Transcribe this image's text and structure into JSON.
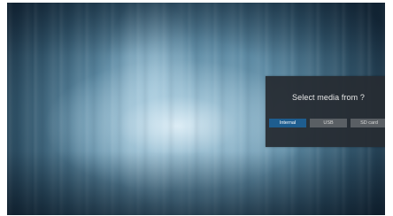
{
  "dialog": {
    "title": "Select media from ?",
    "options": [
      {
        "label": "Internal",
        "selected": true
      },
      {
        "label": "USB",
        "selected": false
      },
      {
        "label": "SD card",
        "selected": false
      }
    ]
  },
  "colors": {
    "selected_option": "#1e5d8f",
    "option": "#5a5f64",
    "dialog_background": "#262c32"
  }
}
